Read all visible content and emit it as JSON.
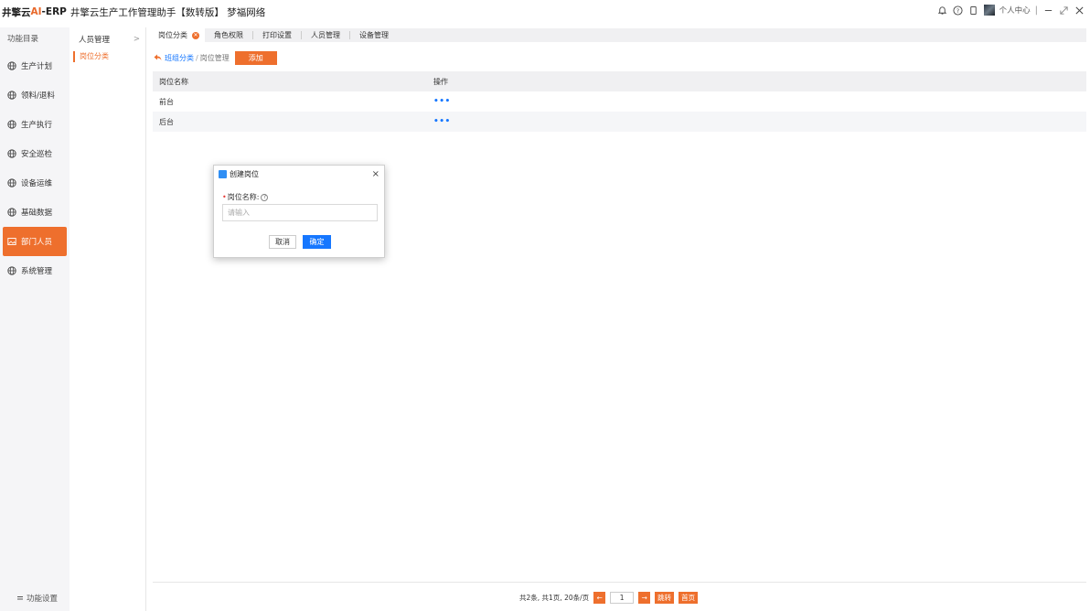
{
  "header": {
    "brand_prefix": "井擎云",
    "brand_ai": "AI",
    "brand_suffix": "-ERP",
    "app_title": "井擎云生产工作管理助手【数转版】 梦福网络",
    "user_center": "个人中心",
    "divider": "|"
  },
  "leftnav": {
    "title": "功能目录",
    "items": [
      {
        "label": "生产计划"
      },
      {
        "label": "领料/退料"
      },
      {
        "label": "生产执行"
      },
      {
        "label": "安全巡检"
      },
      {
        "label": "设备运维"
      },
      {
        "label": "基础数据"
      },
      {
        "label": "部门人员"
      },
      {
        "label": "系统管理"
      }
    ],
    "footer": "功能设置"
  },
  "subnav": {
    "title": "人员管理",
    "chevron": ">",
    "active_item": "岗位分类"
  },
  "tabs": [
    {
      "label": "岗位分类"
    },
    {
      "label": "角色权限"
    },
    {
      "label": "打印设置"
    },
    {
      "label": "人员管理"
    },
    {
      "label": "设备管理"
    }
  ],
  "breadcrumb": {
    "parent": "班组分类",
    "separator": "/",
    "current": "岗位管理",
    "add_button": "添加"
  },
  "table": {
    "columns": [
      "岗位名称",
      "操作"
    ],
    "rows": [
      {
        "name": "前台",
        "action": "•••"
      },
      {
        "name": "后台",
        "action": "•••"
      }
    ]
  },
  "modal": {
    "title": "创建岗位",
    "close": "×",
    "field_label": "岗位名称:",
    "required_mark": "•",
    "help": "?",
    "placeholder": "请输入",
    "cancel": "取消",
    "confirm": "确定"
  },
  "pagination": {
    "summary": "共2条, 共1页, 20条/页",
    "prev": "←",
    "page": "1",
    "next": "→",
    "jump": "跳转",
    "first": "首页"
  },
  "colors": {
    "accent": "#ee6f2d",
    "primary": "#1677ff"
  }
}
